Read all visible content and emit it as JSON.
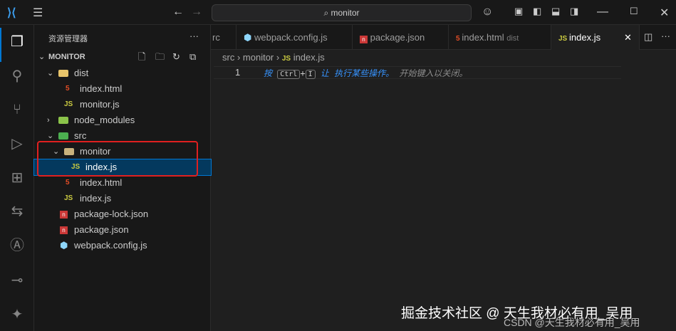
{
  "titlebar": {
    "search": "monitor"
  },
  "sidebar": {
    "title": "资源管理器",
    "more": "···",
    "root": "MONITOR",
    "items": [
      {
        "label": "dist"
      },
      {
        "label": "index.html"
      },
      {
        "label": "monitor.js"
      },
      {
        "label": "node_modules"
      },
      {
        "label": "src"
      },
      {
        "label": "monitor"
      },
      {
        "label": "index.js"
      },
      {
        "label": "index.html"
      },
      {
        "label": "index.js"
      },
      {
        "label": "package-lock.json"
      },
      {
        "label": "package.json"
      },
      {
        "label": "webpack.config.js"
      }
    ]
  },
  "tabs": [
    {
      "label": "rc"
    },
    {
      "label": "webpack.config.js"
    },
    {
      "label": "package.json"
    },
    {
      "label": "index.html",
      "desc": "dist"
    },
    {
      "label": "index.js"
    }
  ],
  "breadcrumb": [
    "src",
    "monitor",
    "index.js"
  ],
  "editor": {
    "line": "1",
    "hint_pre": "按",
    "key1": "Ctrl",
    "plus": "+",
    "key2": "I",
    "hint_mid": "让 执行某些操作。",
    "hint_post": "开始键入以关闭。"
  },
  "watermark": {
    "main": "掘金技术社区 @ 天生我材必有用_吴用",
    "sub": "CSDN @天生我材必有用_吴用"
  }
}
